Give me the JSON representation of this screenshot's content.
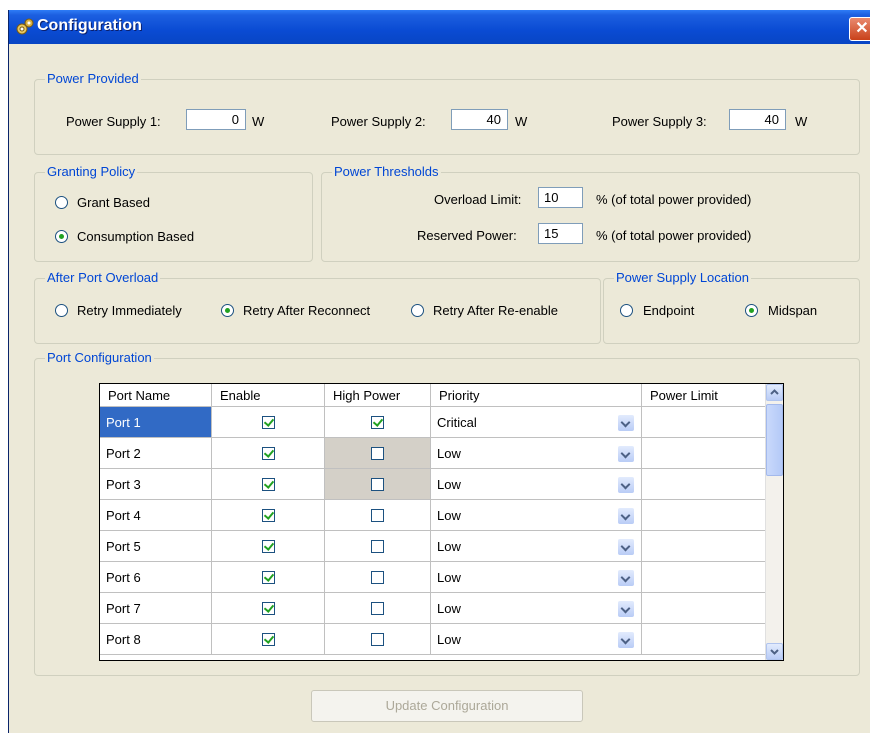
{
  "window": {
    "title": "Configuration",
    "close_label": "✕"
  },
  "power_provided": {
    "group_label": "Power Provided",
    "supply1_label": "Power Supply 1:",
    "supply1_value": "0",
    "supply1_unit": "W",
    "supply2_label": "Power Supply 2:",
    "supply2_value": "40",
    "supply2_unit": "W",
    "supply3_label": "Power Supply 3:",
    "supply3_value": "40",
    "supply3_unit": "W"
  },
  "granting_policy": {
    "group_label": "Granting Policy",
    "options": [
      {
        "label": "Grant Based",
        "selected": false
      },
      {
        "label": "Consumption Based",
        "selected": true
      }
    ]
  },
  "power_thresholds": {
    "group_label": "Power Thresholds",
    "overload_label": "Overload Limit:",
    "overload_value": "10",
    "overload_suffix": "% (of total power provided)",
    "reserved_label": "Reserved Power:",
    "reserved_value": "15",
    "reserved_suffix": "% (of total power provided)"
  },
  "after_port_overload": {
    "group_label": "After Port Overload",
    "options": [
      {
        "label": "Retry Immediately",
        "selected": false
      },
      {
        "label": "Retry After Reconnect",
        "selected": true
      },
      {
        "label": "Retry After Re-enable",
        "selected": false
      }
    ]
  },
  "power_supply_location": {
    "group_label": "Power Supply Location",
    "options": [
      {
        "label": "Endpoint",
        "selected": false
      },
      {
        "label": "Midspan",
        "selected": true
      }
    ]
  },
  "port_configuration": {
    "group_label": "Port Configuration",
    "columns": [
      "Port Name",
      "Enable",
      "High Power",
      "Priority",
      "Power Limit"
    ],
    "rows": [
      {
        "name": "Port 1",
        "enable": true,
        "high_power": true,
        "priority": "Critical",
        "power_limit": ""
      },
      {
        "name": "Port 2",
        "enable": true,
        "high_power": false,
        "priority": "Low",
        "power_limit": ""
      },
      {
        "name": "Port 3",
        "enable": true,
        "high_power": false,
        "priority": "Low",
        "power_limit": ""
      },
      {
        "name": "Port 4",
        "enable": true,
        "high_power": false,
        "priority": "Low",
        "power_limit": ""
      },
      {
        "name": "Port 5",
        "enable": true,
        "high_power": false,
        "priority": "Low",
        "power_limit": ""
      },
      {
        "name": "Port 6",
        "enable": true,
        "high_power": false,
        "priority": "Low",
        "power_limit": ""
      },
      {
        "name": "Port 7",
        "enable": true,
        "high_power": false,
        "priority": "Low",
        "power_limit": ""
      },
      {
        "name": "Port 8",
        "enable": true,
        "high_power": false,
        "priority": "Low",
        "power_limit": ""
      }
    ]
  },
  "update_button_label": "Update Configuration"
}
